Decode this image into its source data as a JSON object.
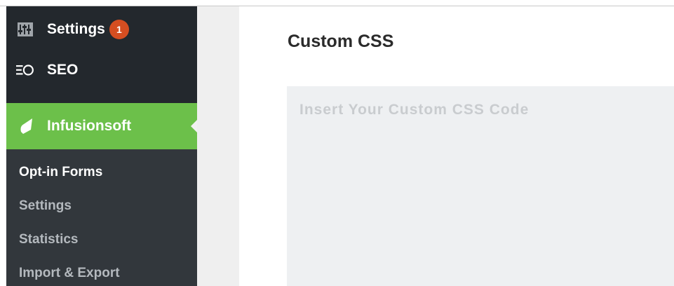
{
  "sidebar": {
    "settings": {
      "label": "Settings",
      "badge": "1",
      "icon": "sliders-icon"
    },
    "seo": {
      "label": "SEO",
      "icon": "seo-icon"
    },
    "infusionsoft": {
      "label": "Infusionsoft",
      "icon": "infusionsoft-leaf-icon"
    },
    "submenu": [
      {
        "label": "Opt-in Forms",
        "current": true
      },
      {
        "label": "Settings",
        "current": false
      },
      {
        "label": "Statistics",
        "current": false
      },
      {
        "label": "Import & Export",
        "current": false
      }
    ]
  },
  "main": {
    "title": "Custom CSS",
    "editor": {
      "placeholder": "Insert Your Custom CSS Code",
      "value": ""
    }
  },
  "colors": {
    "sidebar_bg": "#23282d",
    "submenu_bg": "#32373c",
    "active_green": "#6cc04a",
    "badge_orange": "#d54e21",
    "editor_bg": "#eef0f2"
  }
}
